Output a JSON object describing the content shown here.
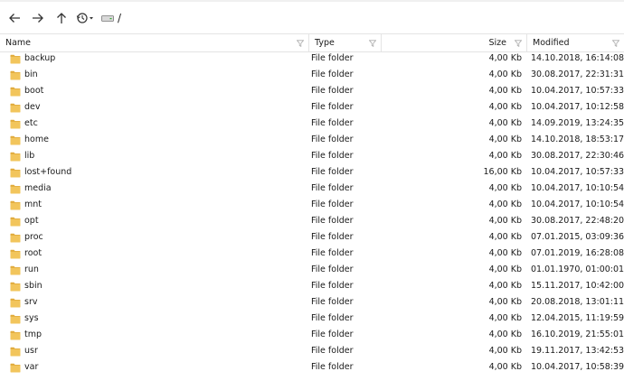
{
  "toolbar": {
    "back": "back-arrow-icon",
    "forward": "forward-arrow-icon",
    "up": "up-arrow-icon",
    "history": "history-icon",
    "drive": "drive-icon",
    "path": "/"
  },
  "columns": {
    "name": "Name",
    "type": "Type",
    "size": "Size",
    "modified": "Modified"
  },
  "colors": {
    "folder": "#f2c55c",
    "folder_tab": "#e0a93a",
    "border": "#e4e4e4"
  },
  "rows": [
    {
      "name": "backup",
      "type": "File folder",
      "size": "4,00 Kb",
      "modified": "14.10.2018, 16:14:08"
    },
    {
      "name": "bin",
      "type": "File folder",
      "size": "4,00 Kb",
      "modified": "30.08.2017, 22:31:31"
    },
    {
      "name": "boot",
      "type": "File folder",
      "size": "4,00 Kb",
      "modified": "10.04.2017, 10:57:33"
    },
    {
      "name": "dev",
      "type": "File folder",
      "size": "4,00 Kb",
      "modified": "10.04.2017, 10:12:58"
    },
    {
      "name": "etc",
      "type": "File folder",
      "size": "4,00 Kb",
      "modified": "14.09.2019, 13:24:35"
    },
    {
      "name": "home",
      "type": "File folder",
      "size": "4,00 Kb",
      "modified": "14.10.2018, 18:53:17"
    },
    {
      "name": "lib",
      "type": "File folder",
      "size": "4,00 Kb",
      "modified": "30.08.2017, 22:30:46"
    },
    {
      "name": "lost+found",
      "type": "File folder",
      "size": "16,00 Kb",
      "modified": "10.04.2017, 10:57:33"
    },
    {
      "name": "media",
      "type": "File folder",
      "size": "4,00 Kb",
      "modified": "10.04.2017, 10:10:54"
    },
    {
      "name": "mnt",
      "type": "File folder",
      "size": "4,00 Kb",
      "modified": "10.04.2017, 10:10:54"
    },
    {
      "name": "opt",
      "type": "File folder",
      "size": "4,00 Kb",
      "modified": "30.08.2017, 22:48:20"
    },
    {
      "name": "proc",
      "type": "File folder",
      "size": "4,00 Kb",
      "modified": "07.01.2015, 03:09:36"
    },
    {
      "name": "root",
      "type": "File folder",
      "size": "4,00 Kb",
      "modified": "07.01.2019, 16:28:08"
    },
    {
      "name": "run",
      "type": "File folder",
      "size": "4,00 Kb",
      "modified": "01.01.1970, 01:00:01"
    },
    {
      "name": "sbin",
      "type": "File folder",
      "size": "4,00 Kb",
      "modified": "15.11.2017, 10:42:00"
    },
    {
      "name": "srv",
      "type": "File folder",
      "size": "4,00 Kb",
      "modified": "20.08.2018, 13:01:11"
    },
    {
      "name": "sys",
      "type": "File folder",
      "size": "4,00 Kb",
      "modified": "12.04.2015, 11:19:59"
    },
    {
      "name": "tmp",
      "type": "File folder",
      "size": "4,00 Kb",
      "modified": "16.10.2019, 21:55:01"
    },
    {
      "name": "usr",
      "type": "File folder",
      "size": "4,00 Kb",
      "modified": "19.11.2017, 13:42:53"
    },
    {
      "name": "var",
      "type": "File folder",
      "size": "4,00 Kb",
      "modified": "10.04.2017, 10:58:39"
    }
  ]
}
